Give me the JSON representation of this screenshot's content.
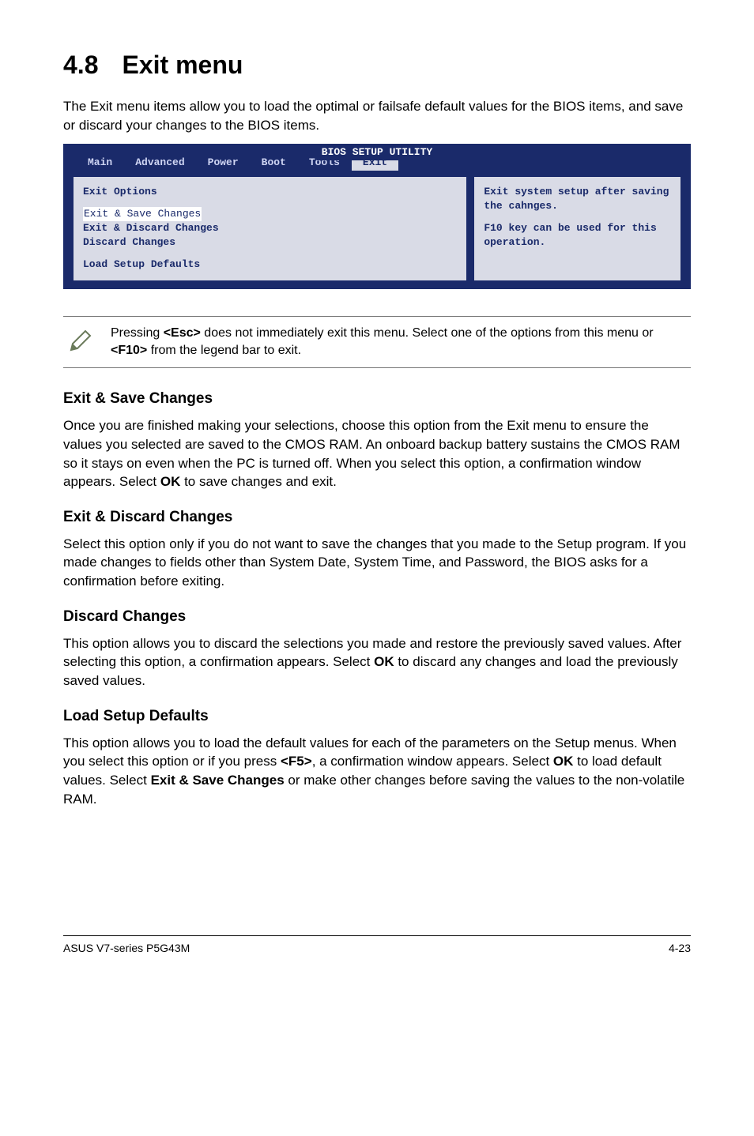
{
  "title": {
    "number": "4.8",
    "text": "Exit menu"
  },
  "intro": "The Exit menu items allow you to load the optimal or failsafe default values for the BIOS items, and save or discard your changes to the BIOS items.",
  "bios": {
    "heading": "BIOS SETUP UTILITY",
    "tabs": [
      "Main",
      "Advanced",
      "Power",
      "Boot",
      "Tools",
      "Exit"
    ],
    "active_tab": "Exit",
    "left": {
      "options_heading": "Exit Options",
      "items": [
        "Exit & Save Changes",
        "Exit & Discard Changes",
        "Discard Changes",
        "Load Setup Defaults"
      ],
      "selected_index": 0
    },
    "right": {
      "line1": "Exit system setup after saving the cahnges.",
      "line2": "F10 key can be used for this operation."
    }
  },
  "note": {
    "pre": "Pressing ",
    "key1": "<Esc>",
    "mid": " does not immediately exit this menu. Select one of the options from this menu or ",
    "key2": "<F10>",
    "post": " from the legend bar to exit."
  },
  "sections": [
    {
      "heading": "Exit & Save Changes",
      "body_pre": "Once you are finished making your selections, choose this option from the Exit menu to ensure the values you selected are saved to the CMOS RAM. An onboard backup battery sustains the CMOS RAM so it stays on even when the PC is turned off. When you select this option, a confirmation window appears. Select ",
      "body_bold": "OK",
      "body_post": " to save changes and exit."
    },
    {
      "heading": "Exit & Discard Changes",
      "body": "Select this option only if you do not want to save the changes that you made to the Setup program. If you made changes to fields other than System Date, System Time, and Password, the BIOS asks for a confirmation before exiting."
    },
    {
      "heading": "Discard Changes",
      "body_pre": "This option allows you to discard the selections you made and restore the previously saved values. After selecting this option, a confirmation appears. Select ",
      "body_bold": "OK",
      "body_post": " to discard any changes and load the previously saved values."
    },
    {
      "heading": "Load Setup Defaults",
      "body_pre": "This option allows you to load the default values for each of the parameters on the Setup menus. When you select this option or if you press ",
      "body_bold1": "<F5>",
      "body_mid": ", a confirmation window appears. Select ",
      "body_bold2": "OK",
      "body_mid2": " to load default values. Select ",
      "body_bold3": "Exit & Save Changes",
      "body_post": " or make other changes before saving the values to the non-volatile RAM."
    }
  ],
  "footer": {
    "left": "ASUS V7-series P5G43M",
    "right": "4-23"
  }
}
